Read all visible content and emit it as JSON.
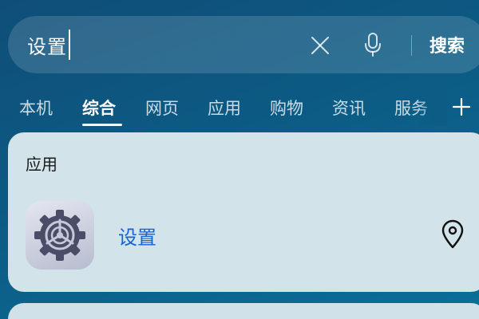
{
  "search": {
    "query": "设置",
    "button_label": "搜索"
  },
  "tabs": [
    {
      "label": "本机",
      "active": false
    },
    {
      "label": "综合",
      "active": true
    },
    {
      "label": "网页",
      "active": false
    },
    {
      "label": "应用",
      "active": false
    },
    {
      "label": "购物",
      "active": false
    },
    {
      "label": "资讯",
      "active": false
    },
    {
      "label": "服务",
      "active": false
    }
  ],
  "results": {
    "section_title": "应用",
    "app": {
      "name": "设置"
    }
  },
  "colors": {
    "accent": "#1463d4",
    "background_top": "#0f4e78",
    "card": "#d3e3ea"
  },
  "icons": [
    "clear-icon",
    "microphone-icon",
    "add-tab-icon",
    "settings-gear-icon",
    "location-pin-icon"
  ]
}
